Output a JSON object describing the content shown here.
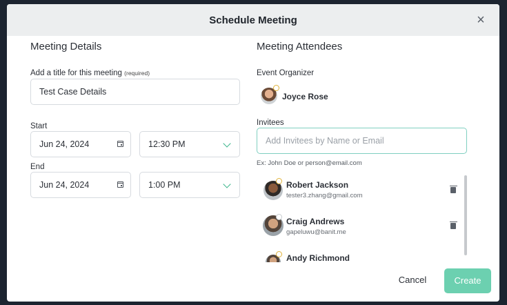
{
  "modal": {
    "title": "Schedule Meeting",
    "close": "×"
  },
  "details": {
    "heading": "Meeting Details",
    "title_label": "Add a title for this meeting",
    "title_required": "(required)",
    "title_value": "Test Case Details",
    "start_label": "Start",
    "start_date": "Jun 24, 2024",
    "start_time": "12:30 PM",
    "end_label": "End",
    "end_date": "Jun 24, 2024",
    "end_time": "1:00 PM"
  },
  "attendees": {
    "heading": "Meeting Attendees",
    "organizer_label": "Event Organizer",
    "organizer_name": "Joyce Rose",
    "invitees_label": "Invitees",
    "invitees_placeholder": "Add Invitees by Name or Email",
    "invitees_hint": "Ex: John Doe or person@email.com",
    "invitees": [
      {
        "name": "Robert Jackson",
        "email": "tester3.zhang@gmail.com"
      },
      {
        "name": "Craig Andrews",
        "email": "gapeluwu@banit.me"
      },
      {
        "name": "Andy Richmond",
        "email": ""
      }
    ]
  },
  "footer": {
    "cancel": "Cancel",
    "create": "Create"
  },
  "colors": {
    "accent": "#38b58a",
    "create_button": "#6cd0b0",
    "focus_border": "#7fcfc0"
  }
}
